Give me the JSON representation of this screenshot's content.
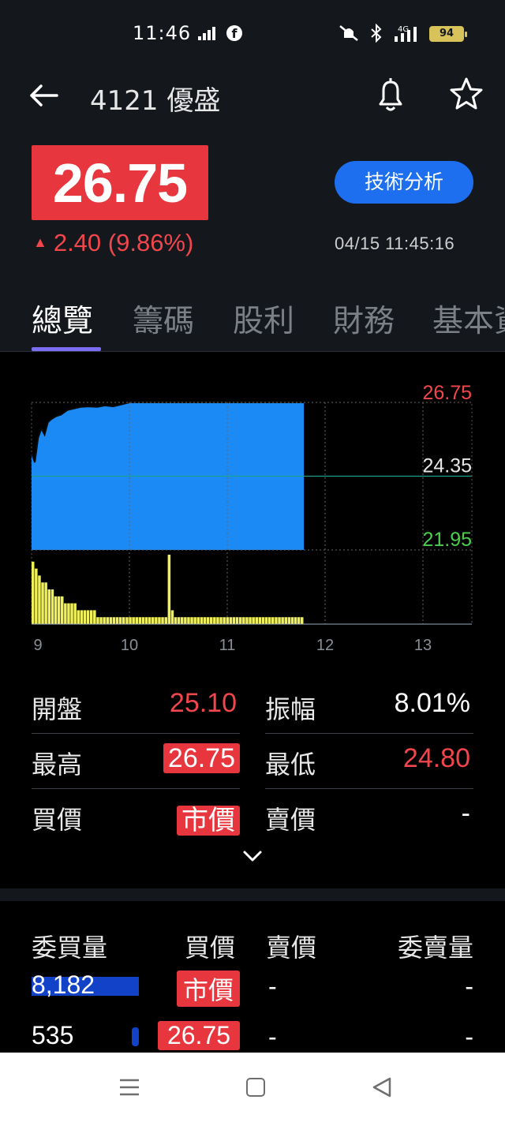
{
  "status_bar": {
    "time": "11:46",
    "battery": "94",
    "network": "4G"
  },
  "header": {
    "title": "4121 優盛",
    "price": "26.75",
    "change": "2.40 (9.86%)",
    "change_arrow": "▲",
    "tech_button": "技術分析",
    "timestamp": "04/15 11:45:16"
  },
  "tabs": [
    "總覽",
    "籌碼",
    "股利",
    "財務",
    "基本資"
  ],
  "chart_data": {
    "type": "area",
    "title": "",
    "y_labels": {
      "high": "26.75",
      "ref": "24.35",
      "low": "21.95"
    },
    "ylim": [
      21.95,
      26.75
    ],
    "x_ticks": [
      "9",
      "10",
      "11",
      "12",
      "13"
    ],
    "price_series": {
      "x_minutes": [
        0,
        2,
        4,
        6,
        8,
        10,
        12,
        15,
        18,
        22,
        26,
        30,
        35,
        40,
        45,
        50,
        55,
        60,
        65,
        70,
        80,
        90,
        100,
        110,
        120,
        130,
        140,
        150,
        160,
        167
      ],
      "values": [
        25.1,
        24.8,
        25.6,
        25.9,
        25.7,
        26.1,
        26.2,
        26.3,
        26.35,
        26.5,
        26.55,
        26.6,
        26.62,
        26.6,
        26.65,
        26.62,
        26.68,
        26.75,
        26.75,
        26.75,
        26.75,
        26.75,
        26.75,
        26.75,
        26.75,
        26.75,
        26.75,
        26.75,
        26.75,
        26.75
      ]
    },
    "volume_series": [
      9,
      8,
      7,
      6,
      6,
      5,
      5,
      4,
      4,
      4,
      3,
      3,
      3,
      3,
      2,
      2,
      2,
      2,
      2,
      2,
      1,
      1,
      1,
      1,
      1,
      1,
      1,
      1,
      1,
      1,
      1,
      1,
      1,
      1,
      1,
      1,
      1,
      1,
      1,
      1,
      1,
      1,
      10,
      2,
      1,
      1,
      1,
      1,
      1,
      1,
      1,
      1,
      1,
      1,
      1,
      1,
      1,
      1,
      1,
      1,
      1,
      1,
      1,
      1,
      1,
      1,
      1,
      1,
      1,
      1,
      1,
      1,
      1,
      1,
      1,
      1,
      1,
      1,
      1,
      1,
      1,
      1,
      1,
      1
    ]
  },
  "stats": {
    "open_label": "開盤",
    "open_value": "25.10",
    "amplitude_label": "振幅",
    "amplitude_value": "8.01%",
    "high_label": "最高",
    "high_value": "26.75",
    "low_label": "最低",
    "low_value": "24.80",
    "bid_label": "買價",
    "bid_value": "市價",
    "ask_label": "賣價",
    "ask_value": "-"
  },
  "order_book": {
    "headers": [
      "委買量",
      "買價",
      "賣價",
      "委賣量"
    ],
    "rows": [
      {
        "bid_vol": "8,182",
        "bid": "市價",
        "ask": "-",
        "ask_vol": "-",
        "bar_fraction": 1.0
      },
      {
        "bid_vol": "535",
        "bid": "26.75",
        "ask": "-",
        "ask_vol": "-",
        "bar_fraction": 0.065
      }
    ]
  },
  "colors": {
    "accent": "#1d6ff0",
    "up": "#f2464d",
    "down": "#4ccf4c",
    "volume": "#f0f05a",
    "area": "#1b8af5"
  }
}
